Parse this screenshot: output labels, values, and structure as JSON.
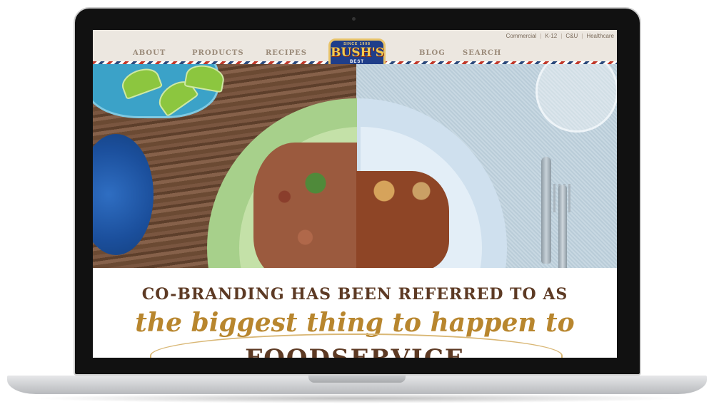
{
  "utility_links": [
    "Commercial",
    "K-12",
    "C&U",
    "Healthcare"
  ],
  "nav": {
    "about": "ABOUT",
    "products": "PRODUCTS",
    "recipes": "RECIPES",
    "blog": "BLOG",
    "search": "SEARCH"
  },
  "logo": {
    "top": "SINCE 1908",
    "main": "BUSH'S",
    "bottom": "BEST"
  },
  "headline": {
    "line1": "CO-BRANDING HAS BEEN REFERRED TO AS",
    "line2": "the biggest thing to happen to",
    "line3": "FOODSERVICE"
  },
  "colors": {
    "brown": "#5d3a24",
    "gold": "#b8862e",
    "nav_bg": "#ece7e0",
    "nav_text": "#9b8b7a",
    "logo_blue": "#1f3e8a"
  }
}
